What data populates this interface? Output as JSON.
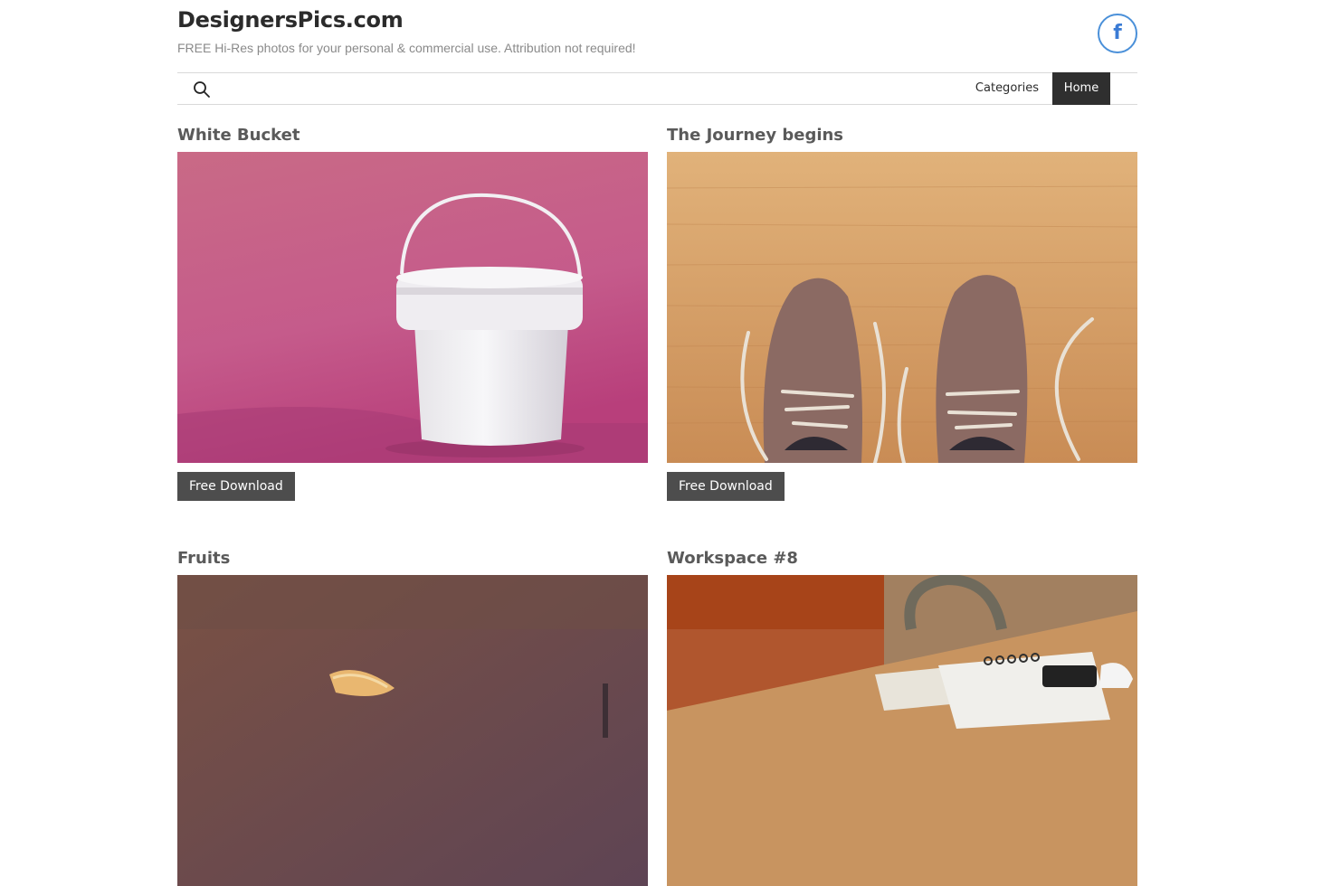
{
  "site": {
    "title": "DesignersPics.com",
    "tagline": "FREE Hi-Res photos for your personal & commercial use. Attribution not required!"
  },
  "social": {
    "facebook_icon": "facebook-icon",
    "facebook_glyph": "f",
    "color": "#4a90d9"
  },
  "nav": {
    "search_icon": "search-icon",
    "items": [
      {
        "label": "Categories",
        "active": false
      },
      {
        "label": "Home",
        "active": true
      }
    ]
  },
  "posts": [
    {
      "title": "White Bucket",
      "button": "Free Download",
      "image": "white-bucket-photo"
    },
    {
      "title": "The Journey begins",
      "button": "Free Download",
      "image": "brown-shoes-photo"
    },
    {
      "title": "Fruits",
      "button": "",
      "image": "fruits-photo"
    },
    {
      "title": "Workspace #8",
      "button": "",
      "image": "workspace-photo"
    }
  ],
  "colors": {
    "nav_active_bg": "#2f2f2f",
    "button_bg": "#4d4d4d",
    "title_text": "#5a5a5a"
  }
}
